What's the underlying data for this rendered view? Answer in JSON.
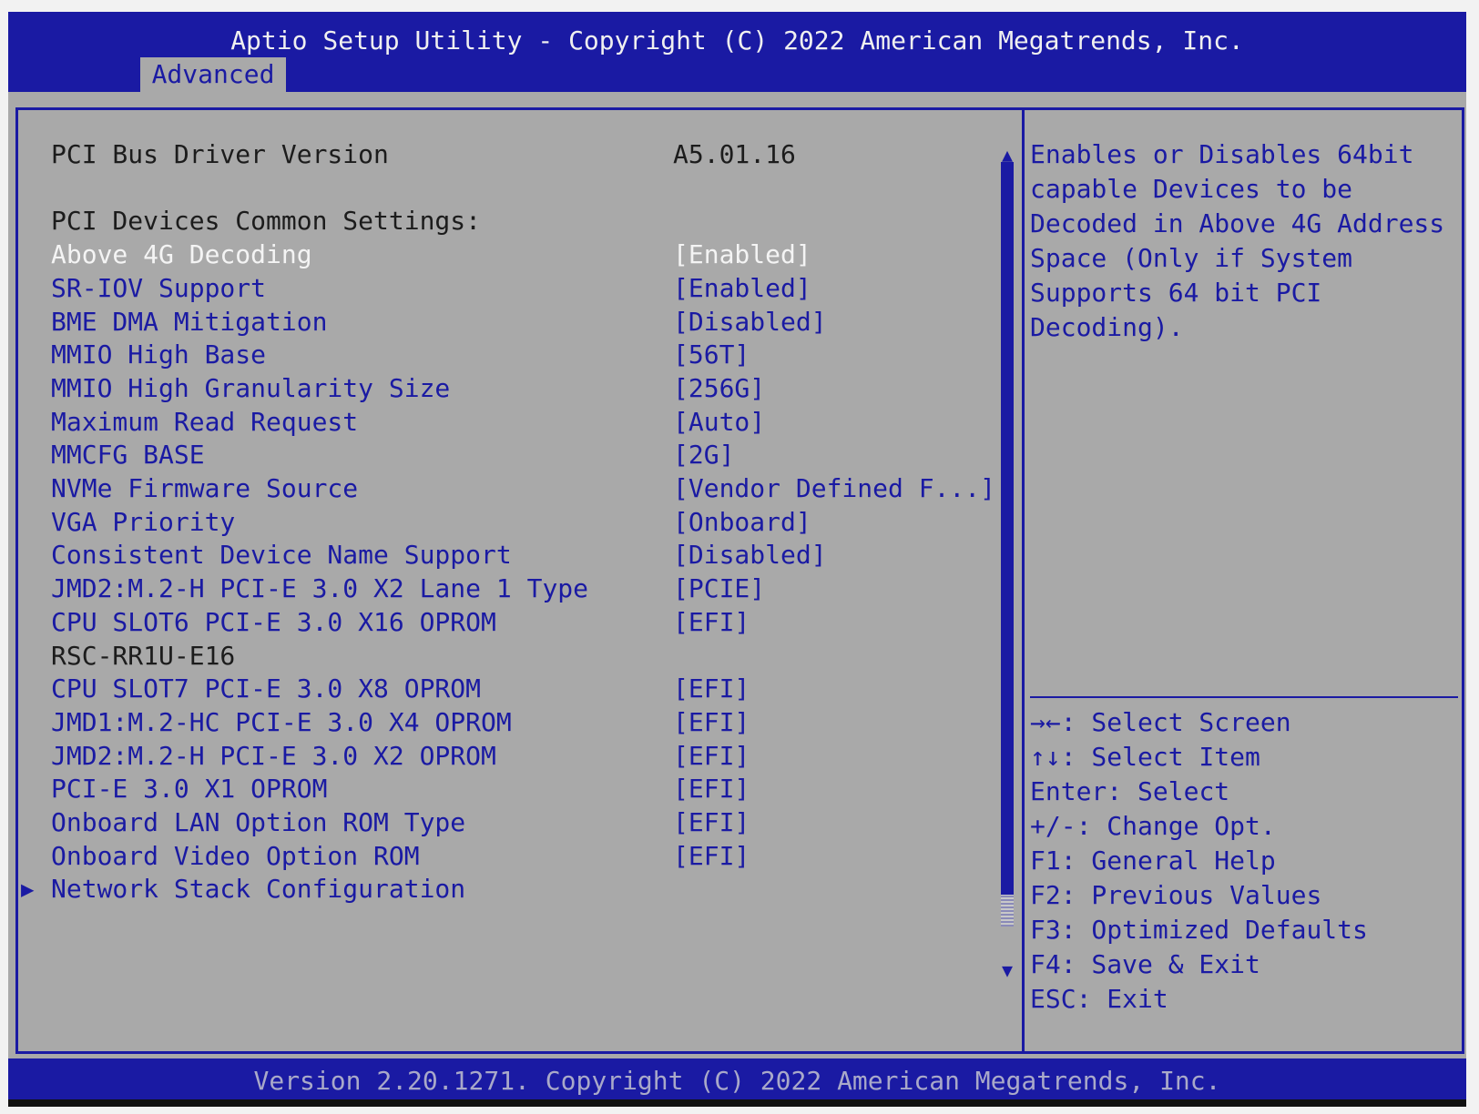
{
  "header": {
    "title": "Aptio Setup Utility - Copyright (C) 2022 American Megatrends, Inc.",
    "tab": "Advanced"
  },
  "settings": [
    {
      "label": "PCI Bus Driver Version",
      "value": "A5.01.16",
      "type": "static"
    },
    {
      "label": "",
      "value": "",
      "type": "blank"
    },
    {
      "label": "PCI Devices Common Settings:",
      "value": "",
      "type": "static"
    },
    {
      "label": "Above 4G Decoding",
      "value": "[Enabled]",
      "type": "selected"
    },
    {
      "label": "SR-IOV Support",
      "value": "[Enabled]",
      "type": "option"
    },
    {
      "label": "BME DMA Mitigation",
      "value": "[Disabled]",
      "type": "option"
    },
    {
      "label": "MMIO High Base",
      "value": "[56T]",
      "type": "option"
    },
    {
      "label": "MMIO High Granularity Size",
      "value": "[256G]",
      "type": "option"
    },
    {
      "label": "Maximum Read Request",
      "value": "[Auto]",
      "type": "option"
    },
    {
      "label": "MMCFG BASE",
      "value": "[2G]",
      "type": "option"
    },
    {
      "label": "NVMe Firmware Source",
      "value": "[Vendor Defined F...]",
      "type": "option"
    },
    {
      "label": "VGA Priority",
      "value": "[Onboard]",
      "type": "option"
    },
    {
      "label": "Consistent Device Name Support",
      "value": "[Disabled]",
      "type": "option"
    },
    {
      "label": "JMD2:M.2-H PCI-E 3.0 X2 Lane 1 Type",
      "value": "[PCIE]",
      "type": "option"
    },
    {
      "label": "CPU SLOT6 PCI-E 3.0 X16 OPROM",
      "value": "[EFI]",
      "type": "option"
    },
    {
      "label": "RSC-RR1U-E16",
      "value": "",
      "type": "static"
    },
    {
      "label": "CPU SLOT7 PCI-E 3.0 X8 OPROM",
      "value": "[EFI]",
      "type": "option"
    },
    {
      "label": "JMD1:M.2-HC PCI-E 3.0 X4 OPROM",
      "value": "[EFI]",
      "type": "option"
    },
    {
      "label": "JMD2:M.2-H PCI-E 3.0 X2 OPROM",
      "value": "[EFI]",
      "type": "option"
    },
    {
      "label": "PCI-E 3.0 X1 OPROM",
      "value": "[EFI]",
      "type": "option"
    },
    {
      "label": "Onboard LAN Option ROM Type",
      "value": "[EFI]",
      "type": "option"
    },
    {
      "label": "Onboard Video Option ROM",
      "value": "[EFI]",
      "type": "option"
    },
    {
      "label": "Network Stack Configuration",
      "value": "",
      "type": "submenu"
    }
  ],
  "help_lines": [
    "Enables or Disables 64bit",
    "capable Devices to be",
    "Decoded in Above 4G Address",
    "Space (Only if System",
    "Supports 64 bit PCI",
    "Decoding)."
  ],
  "keys": [
    {
      "key": "→←",
      "text": ": Select Screen"
    },
    {
      "key": "↑↓",
      "text": ": Select Item"
    },
    {
      "key": "Enter",
      "text": ": Select"
    },
    {
      "key": "+/-",
      "text": ": Change Opt."
    },
    {
      "key": "F1",
      "text": ": General Help"
    },
    {
      "key": "F2",
      "text": ": Previous Values"
    },
    {
      "key": "F3",
      "text": ": Optimized Defaults"
    },
    {
      "key": "F4",
      "text": ": Save & Exit"
    },
    {
      "key": "ESC",
      "text": ": Exit"
    }
  ],
  "icons": {
    "scroll_up": "▲",
    "scroll_down": "▼",
    "submenu": "▶"
  },
  "footer": {
    "version": "Version 2.20.1271. Copyright (C) 2022 American Megatrends, Inc."
  },
  "colors": {
    "bios_blue": "#1a1aa3",
    "bios_gray": "#a9a9a9",
    "selected_text": "#f4f4f4"
  }
}
